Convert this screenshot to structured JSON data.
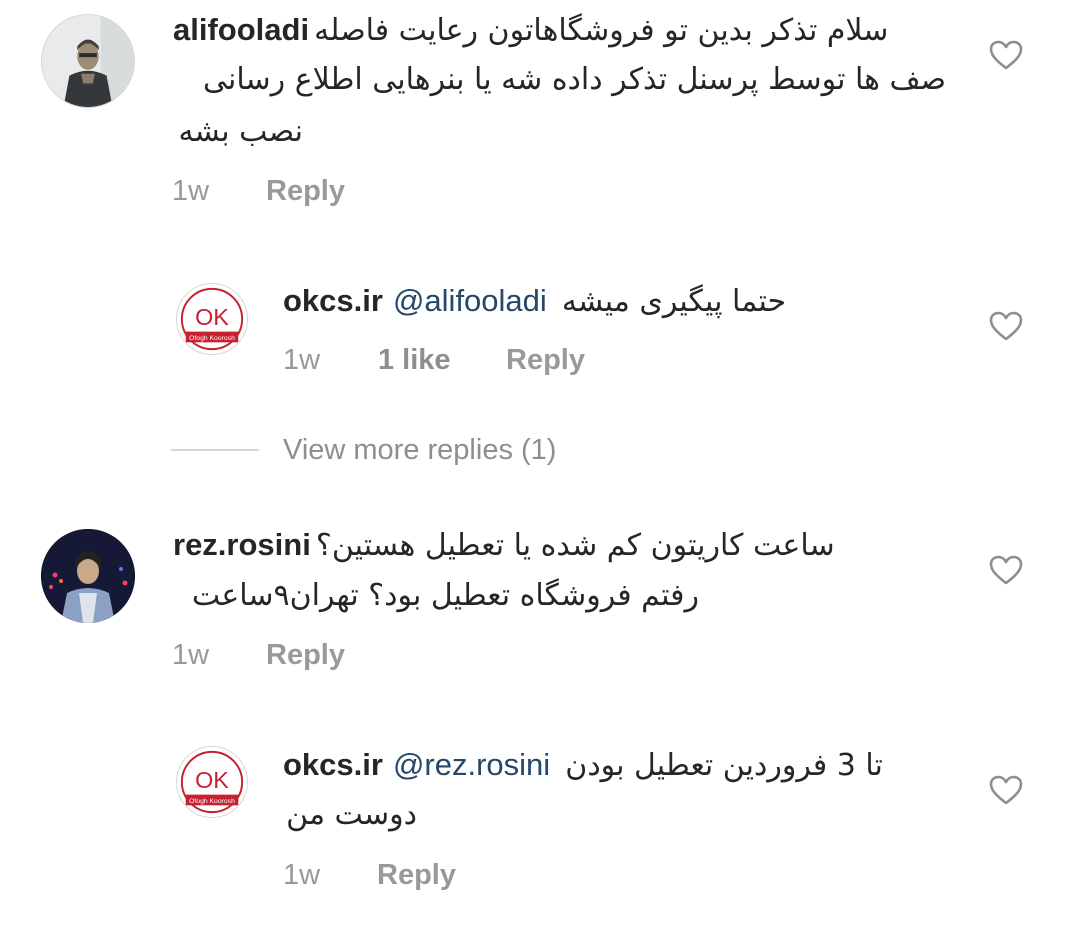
{
  "comments": [
    {
      "username": "alifooladi",
      "avatar": "user-photo-avatar",
      "lines": [
        "سلام تذکر بدین تو فروشگاهاتون رعایت فاصله",
        "صف ها توسط پرسنل تذکر داده شه یا بنرهایی اطلاع رسانی",
        "نصب بشه"
      ],
      "time": "1w",
      "reply_label": "Reply",
      "like_icon": "heart-outline-icon",
      "replies": [
        {
          "username": "okcs.ir",
          "avatar": "ok-logo-avatar",
          "logo_text": "OK",
          "logo_subtext": "Ofogh Koorosh",
          "mention": "@alifooladi",
          "text": "حتما پیگیری میشه",
          "time": "1w",
          "likes": "1 like",
          "reply_label": "Reply",
          "like_icon": "heart-outline-icon"
        }
      ],
      "view_more": "View more replies (1)"
    },
    {
      "username": "rez.rosini",
      "avatar": "user-photo-avatar",
      "lines": [
        "ساعت کاریتون کم شده یا تعطیل هستین؟",
        "رفتم فروشگاه تعطیل بود؟ تهران۹ساعت"
      ],
      "time": "1w",
      "reply_label": "Reply",
      "like_icon": "heart-outline-icon",
      "replies": [
        {
          "username": "okcs.ir",
          "avatar": "ok-logo-avatar",
          "logo_text": "OK",
          "logo_subtext": "Ofogh Koorosh",
          "mention": "@rez.rosini",
          "text": "تا 3 فروردین تعطیل بودن",
          "text_line2": "دوست من",
          "time": "1w",
          "reply_label": "Reply",
          "like_icon": "heart-outline-icon"
        }
      ]
    }
  ],
  "colors": {
    "text": "#262626",
    "mention": "#24476b",
    "meta": "#999999",
    "brand_red": "#c8202f",
    "divider": "#d6d6d6"
  }
}
